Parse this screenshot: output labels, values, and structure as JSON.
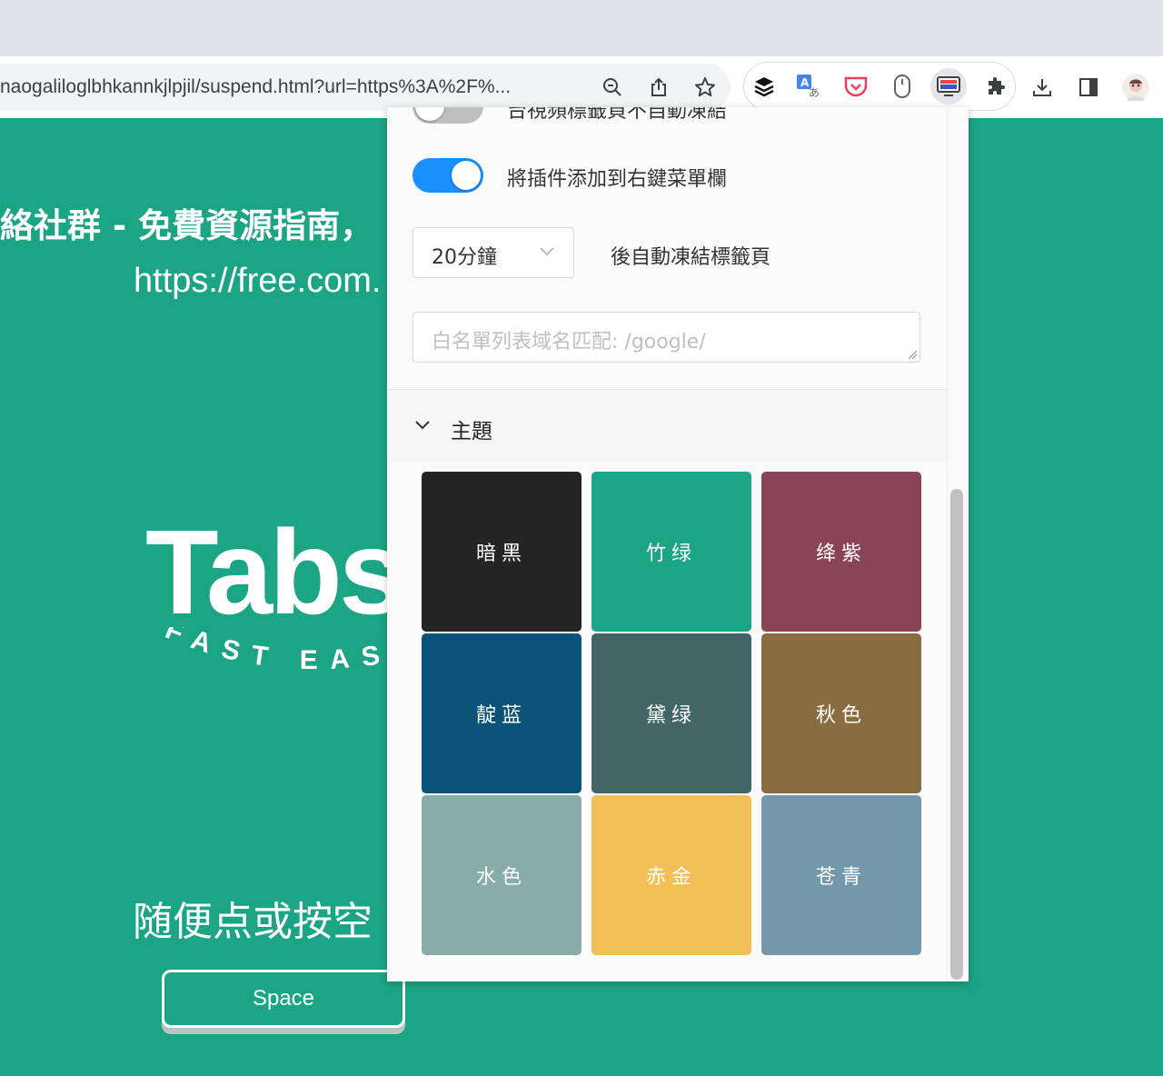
{
  "browser": {
    "url": "naogaliloglbhkannkjlpjil/suspend.html?url=https%3A%2F%...",
    "toolbar_icons": [
      "zoom-icon",
      "share-icon",
      "star-icon"
    ],
    "extensions": [
      "layers-icon",
      "translate-icon",
      "pocket-icon",
      "mouse-icon",
      "tab-suspender-icon"
    ],
    "right_icons": [
      "puzzle-icon",
      "download-icon",
      "sidepanel-icon",
      "profile-avatar"
    ]
  },
  "page": {
    "headline": "絡社群 - 免費資源指南，",
    "url_text": "https://free.com.",
    "logo_word": "Tabs",
    "logo_sub": "FAST EAS",
    "hint": "随便点或按空",
    "space_button": "Space",
    "colors": {
      "background": "#1ca584"
    }
  },
  "popup": {
    "partial_label": "台視頻標籤頁不自動凍結",
    "context_menu_label": "將插件添加到右鍵菜單欄",
    "context_menu_enabled": true,
    "top_toggle_enabled": false,
    "freeze_select_value": "20分鐘",
    "freeze_label": "後自動凍結標籤頁",
    "whitelist_placeholder": "白名單列表域名匹配: /google/",
    "theme_section_title": "主題",
    "themes": [
      {
        "label": "暗黑",
        "color": "#242424"
      },
      {
        "label": "竹绿",
        "color": "#1ca584"
      },
      {
        "label": "绛紫",
        "color": "#8b4356"
      },
      {
        "label": "靛蓝",
        "color": "#0b5279"
      },
      {
        "label": "黛绿",
        "color": "#426666"
      },
      {
        "label": "秋色",
        "color": "#896c40"
      },
      {
        "label": "水色",
        "color": "#88ada6"
      },
      {
        "label": "赤金",
        "color": "#f2be56"
      },
      {
        "label": "苍青",
        "color": "#7397ab"
      }
    ],
    "toggle_on_color": "#1890ff"
  }
}
